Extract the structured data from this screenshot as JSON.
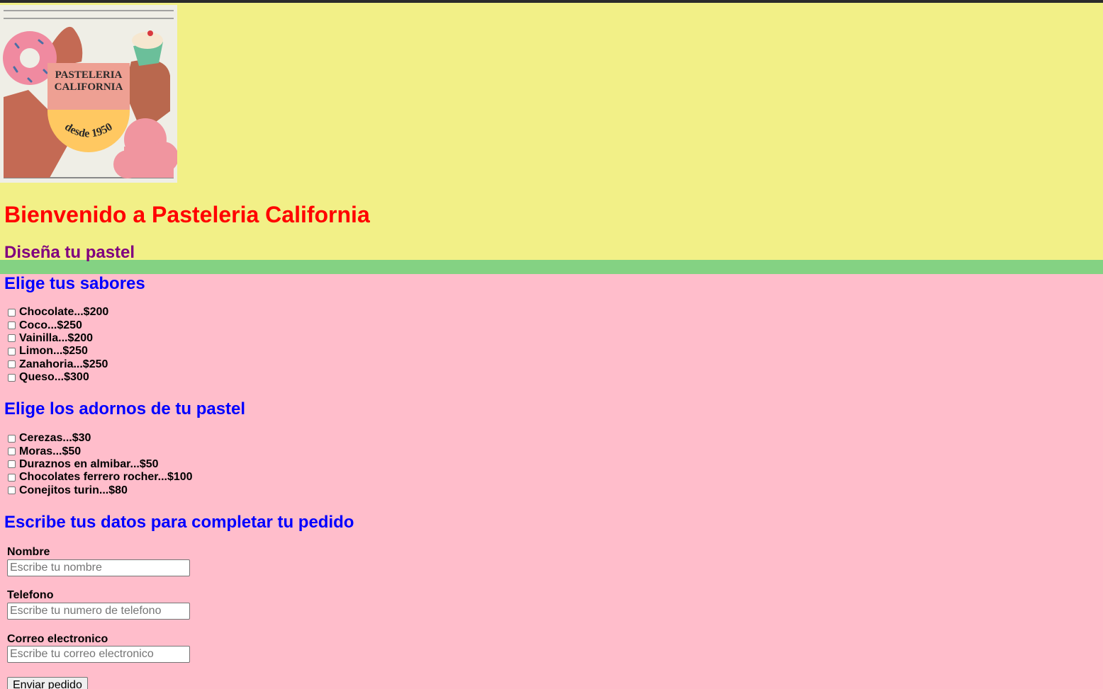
{
  "header": {
    "logo": {
      "line1": "PASTELERIA",
      "line2": "CALIFORNIA",
      "since": "desde 1950"
    },
    "title": "Bienvenido a Pasteleria California",
    "subtitle": "Diseña tu pastel"
  },
  "flavors": {
    "title": "Elige tus sabores",
    "items": [
      {
        "label": "Chocolate...$200",
        "checked": false
      },
      {
        "label": "Coco...$250",
        "checked": false
      },
      {
        "label": "Vainilla...$200",
        "checked": false
      },
      {
        "label": "Limon...$250",
        "checked": false
      },
      {
        "label": "Zanahoria...$250",
        "checked": false
      },
      {
        "label": "Queso...$300",
        "checked": false
      }
    ]
  },
  "toppings": {
    "title": "Elige los adornos de tu pastel",
    "items": [
      {
        "label": "Cerezas...$30",
        "checked": false
      },
      {
        "label": "Moras...$50",
        "checked": false
      },
      {
        "label": "Duraznos en almibar...$50",
        "checked": false
      },
      {
        "label": "Chocolates ferrero rocher...$100",
        "checked": false
      },
      {
        "label": "Conejitos turin...$80",
        "checked": false
      }
    ]
  },
  "form": {
    "title": "Escribe tus datos para completar tu pedido",
    "name": {
      "label": "Nombre",
      "placeholder": "Escribe tu nombre",
      "value": ""
    },
    "phone": {
      "label": "Telefono",
      "placeholder": "Escribe tu numero de telefono",
      "value": ""
    },
    "email": {
      "label": "Correo electronico",
      "placeholder": "Escribe tu correo electronico",
      "value": ""
    },
    "submit_label": "Enviar pedido"
  },
  "colors": {
    "header_bg": "#f2f087",
    "divider": "#84d283",
    "body_bg": "#ffbdcb",
    "title": "#ff0000",
    "subtitle": "#800080",
    "section_title": "#0000ff"
  }
}
